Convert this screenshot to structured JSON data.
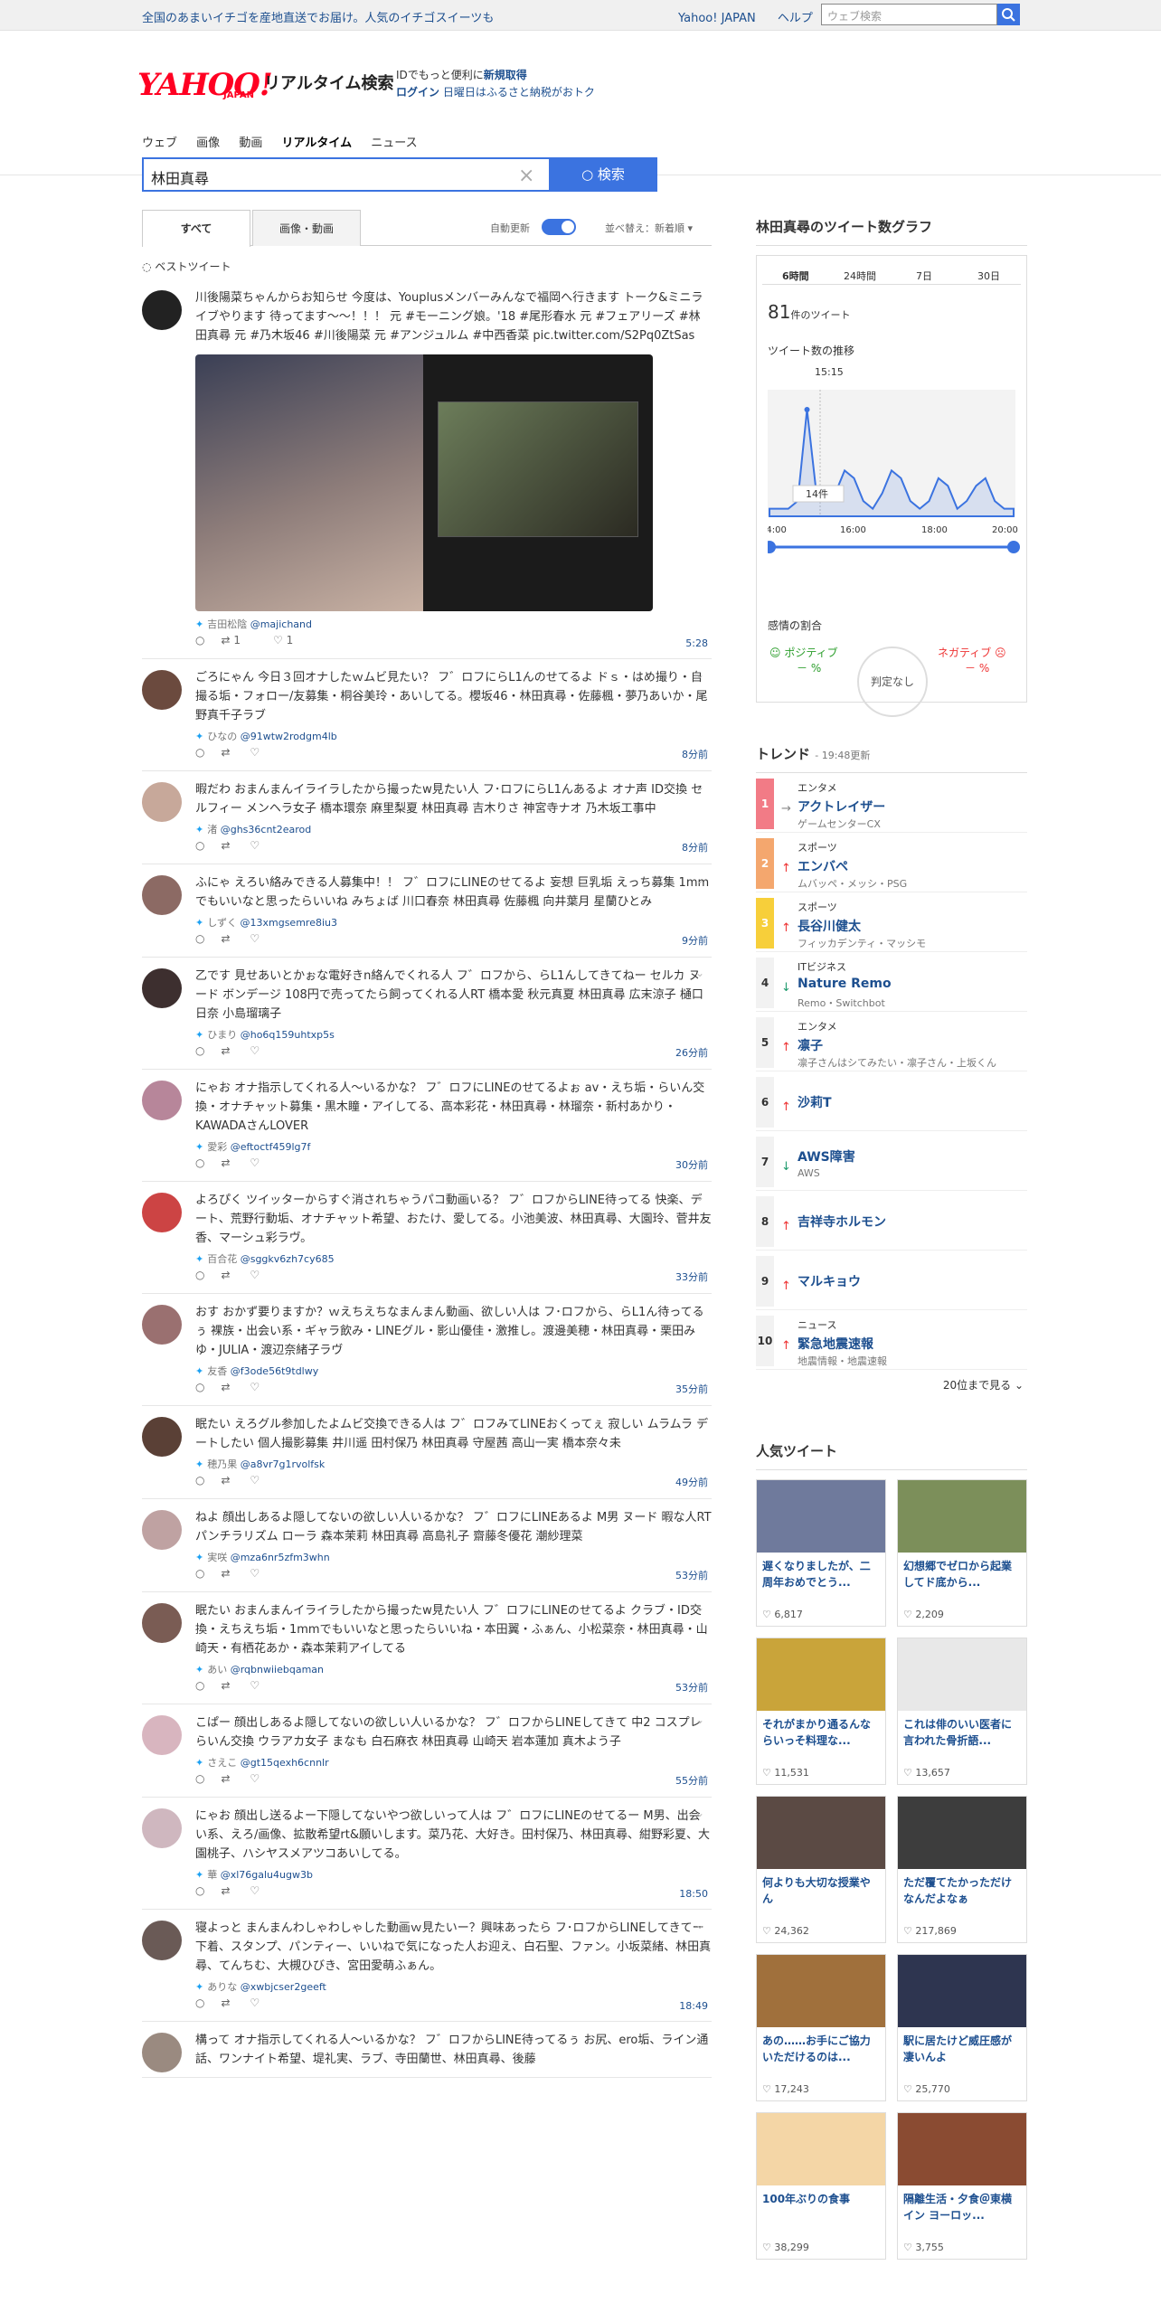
{
  "topbar": {
    "promo": "全国のあまいイチゴを産地直送でお届け。人気のイチゴスイーツも",
    "links": [
      "Yahoo! JAPAN",
      "ヘルプ"
    ],
    "search_placeholder": "ウェブ検索"
  },
  "header": {
    "logo": "YAHOO!",
    "logo_sub": "JAPAN",
    "title": "リアルタイム検索",
    "account_line1": "IDでもっと便利に",
    "account_link1": "新規取得",
    "account_link2": "ログイン",
    "account_line2": "日曜日はふるさと納税がおトク"
  },
  "nav": [
    "ウェブ",
    "画像",
    "動画",
    "リアルタイム",
    "ニュース"
  ],
  "search": {
    "query": "林田真尋",
    "button": "検索"
  },
  "tabs": {
    "all": "すべて",
    "media": "画像・動画",
    "auto_update": "自動更新",
    "sort": "並べ替え：新着順"
  },
  "best_label": "ベストツイート",
  "tweets": [
    {
      "text": "川後陽菜ちゃんからお知らせ 今度は、Youplusメンバーみんなで福岡へ行きます トーク&ミニライブやります 待ってます〜〜！！！ 元 #モーニング娘。'18 #尾形春水 元 #フェアリーズ #林田真尋 元 #乃木坂46 #川後陽菜 元 #アンジュルム #中西香菜 pic.twitter.com/S2Pq0ZtSas",
      "user": "吉田松陰",
      "screen": "@majichand",
      "time": "5:28",
      "rt": "1",
      "like": "1"
    },
    {
      "text": "ごろにゃん 今日３回オナしたｗムビ見たい？ フ゛ロフにらL1んのせてるよ ドｓ・はめ撮り・自撮る垢・フォロー/友募集・桐谷美玲・あいしてる。櫻坂46・林田真尋・佐藤楓・夢乃あいか・尾野真千子ラブ",
      "user": "ひなの",
      "screen": "@91wtw2rodgm4lb",
      "time": "8分前"
    },
    {
      "text": "暇だわ おまんまんイライラしたから撮ったw見たい人 フ･ロフにらL1んあるよ オナ声 ID交換 セルフィー メンヘラ女子 橋本環奈 麻里梨夏 林田真尋 吉木りさ 神宮寺ナオ 乃木坂工事中",
      "user": "渚",
      "screen": "@ghs36cnt2earod",
      "time": "8分前"
    },
    {
      "text": "ふにゃ えろい絡みできる人募集中！！ フ゛ロフにLINEのせてるよ 妄想 巨乳垢 えっち募集 1mmでもいいなと思ったらいいね みちょば 川口春奈 林田真尋 佐藤楓 向井葉月 星蘭ひとみ",
      "user": "しずく",
      "screen": "@13xmgsemre8iu3",
      "time": "9分前"
    },
    {
      "text": "乙です 見せあいとかぉな電好きn絡んでくれる人 フ゛ロフから、らL1んしてきてねー セルカ ヌード ボンデージ 108円で売ってたら飼ってくれる人RT 橋本愛 秋元真夏 林田真尋 広末涼子 樋口日奈 小島瑠璃子",
      "user": "ひまり",
      "screen": "@ho6q159uhtxp5s",
      "time": "26分前"
    },
    {
      "text": "にゃお オナ指示してくれる人〜いるかな？ フ゛ロフにLINEのせてるよぉ av・えち垢・らいん交換・オナチャット募集・黒木瞳・アイしてる、高本彩花・林田真尋・林瑠奈・新村あかり・KAWADAさんLOVER",
      "user": "愛彩",
      "screen": "@eftoctf459lg7f",
      "time": "30分前"
    },
    {
      "text": "よろぴく ツイッターからすぐ消されちゃうパコ動画いる？ フ゛ロフからLINE待ってる 快楽、デート、荒野行動垢、オナチャット希望、おたけ、愛してる。小池美波、林田真尋、大園玲、菅井友香、マーシュ彩ラヴ。",
      "user": "百合花",
      "screen": "@sggkv6zh7cy685",
      "time": "33分前"
    },
    {
      "text": "おす おかず要りますか？ｗえちえちなまんまん動画、欲しい人は フ･ロフから、らL1ん待ってるぅ 裸族・出会い系・ギャラ飲み・LINEグル・影山優佳・激推し。渡邊美穂・林田真尋・栗田みゆ・JULIA・渡辺奈緒子ラヴ",
      "user": "友香",
      "screen": "@f3ode56t9tdlwy",
      "time": "35分前"
    },
    {
      "text": "眠たい えろグル参加したよムビ交換できる人は フ゛ロフみてLINEおくってぇ 寂しい ムラムラ デートしたい 個人撮影募集 井川遥 田村保乃 林田真尋 守屋茜 高山一実 橋本奈々未",
      "user": "穂乃果",
      "screen": "@a8vr7g1rvolfsk",
      "time": "49分前"
    },
    {
      "text": "ねよ 顔出しあるよ隠してないの欲しい人いるかな？ フ゛ロフにLINEあるよ M男 ヌード 暇な人RT パンチラリズム ローラ 森本茉莉 林田真尋 高島礼子 齋藤冬優花 潮紗理菜",
      "user": "実咲",
      "screen": "@mza6nr5zfm3whn",
      "time": "53分前"
    },
    {
      "text": "眠たい おまんまんイライラしたから撮ったw見たい人 フ゛ロフにLINEのせてるよ クラブ・ID交換・えちえち垢・1mmでもいいなと思ったらいいね・本田翼・ふぁん、小松菜奈・林田真尋・山崎天・有栖花あか・森本茉莉アイしてる",
      "user": "あい",
      "screen": "@rqbnwiiebqaman",
      "time": "53分前"
    },
    {
      "text": "こぱー 顔出しあるよ隠してないの欲しい人いるかな？ フ゛ロフからLINEしてきて 中2 コスプレ らいん交換 ウラアカ女子 まなも 白石麻衣 林田真尋 山崎天 岩本蓮加 真木よう子",
      "user": "さえこ",
      "screen": "@gt15qexh6cnnlr",
      "time": "55分前"
    },
    {
      "text": "にゃお 顔出し送るよー下隠してないやつ欲しいって人は フ゛ロフにLINEのせてるー M男、出会い系、えろ/画像、拡散希望rt&願いします。菜乃花、大好き。田村保乃、林田真尋、紺野彩夏、大園桃子、ハシヤスメアツコあいしてる。",
      "user": "華",
      "screen": "@xl76galu4ugw3b",
      "time": "18:50"
    },
    {
      "text": "寝よっと まんまんわしゃわしゃした動画ｗ見たいー？興味あったら フ･ロフからLINEしてきてー 下着、スタンプ、パンティー、いいねで気になった人お迎え、白石聖、ファン。小坂菜緒、林田真尋、てんちむ、大槻ひびき、宮田愛萌ふぁん。",
      "user": "ありな",
      "screen": "@xwbjcser2geeft",
      "time": "18:49"
    },
    {
      "text": "構って オナ指示してくれる人〜いるかな？ フ゛ロフからLINE待ってるぅ お尻、ero垢、ライン通話、ワンナイト希望、堤礼実、ラブ、寺田蘭世、林田真尋、後藤",
      "user": "",
      "screen": "",
      "time": ""
    }
  ],
  "graph": {
    "title": "林田真尋のツイート数グラフ",
    "tabs": [
      "6時間",
      "24時間",
      "7日",
      "30日"
    ],
    "count": "81",
    "count_unit": "件のツイート",
    "trend_label": "ツイート数の推移",
    "peak_time": "15:15",
    "peak_count": "14件",
    "xticks": [
      "14:00",
      "16:00",
      "18:00",
      "20:00"
    ],
    "series": [
      1,
      1,
      1,
      2,
      14,
      3,
      2,
      3,
      6,
      5,
      2,
      1,
      3,
      6,
      5,
      2,
      1,
      2,
      5,
      4,
      1,
      2,
      4,
      5,
      2,
      1,
      1
    ],
    "emotion_label": "感情の割合",
    "positive": "ポジティブ",
    "negative": "ネガティブ",
    "neutral": "判定なし",
    "pos_val": "－ %",
    "neg_val": "－ %"
  },
  "trend": {
    "title": "トレンド",
    "updated": "19:48更新",
    "items": [
      {
        "rank": "1",
        "cat": "エンタメ",
        "name": "アクトレイザー",
        "sub": "ゲームセンターCX",
        "dir": "flat"
      },
      {
        "rank": "2",
        "cat": "スポーツ",
        "name": "エンバペ",
        "sub": "ムバッペ・メッシ・PSG",
        "dir": "up"
      },
      {
        "rank": "3",
        "cat": "スポーツ",
        "name": "長谷川健太",
        "sub": "フィッカデンティ・マッシモ",
        "dir": "up"
      },
      {
        "rank": "4",
        "cat": "ITビジネス",
        "name": "Nature Remo",
        "sub": "Remo・Switchbot",
        "dir": "down"
      },
      {
        "rank": "5",
        "cat": "エンタメ",
        "name": "凛子",
        "sub": "凛子さんはシてみたい・凛子さん・上坂くん",
        "dir": "up"
      },
      {
        "rank": "6",
        "cat": "",
        "name": "沙莉T",
        "sub": "",
        "dir": "up"
      },
      {
        "rank": "7",
        "cat": "",
        "name": "AWS障害",
        "sub": "AWS",
        "dir": "down"
      },
      {
        "rank": "8",
        "cat": "",
        "name": "吉祥寺ホルモン",
        "sub": "",
        "dir": "up"
      },
      {
        "rank": "9",
        "cat": "",
        "name": "マルキョウ",
        "sub": "",
        "dir": "up"
      },
      {
        "rank": "10",
        "cat": "ニュース",
        "name": "緊急地震速報",
        "sub": "地震情報・地震速報",
        "dir": "up"
      }
    ],
    "more": "20位まで見る"
  },
  "popular": {
    "title": "人気ツイート",
    "cards": [
      {
        "title": "遅くなりましたが、二周年おめでとう...",
        "likes": "6,817",
        "color": "#6f7a9c"
      },
      {
        "title": "幻想郷でゼロから起業してド底から...",
        "likes": "2,209",
        "color": "#7c8f5a"
      },
      {
        "title": "それがまかり通るんならいっそ料理な...",
        "likes": "11,531",
        "color": "#c9a43a"
      },
      {
        "title": "これは俳のいい医者に言われた骨折語...",
        "likes": "13,657",
        "color": "#e8e8e8"
      },
      {
        "title": "何よりも大切な授業やん",
        "likes": "24,362",
        "color": "#5b4a44"
      },
      {
        "title": "ただ覆てたかっただけなんだよなぁ",
        "likes": "217,869",
        "color": "#3d3d3d"
      },
      {
        "title": "あの……お手にご協力いただけるのは...",
        "likes": "17,243",
        "color": "#a0703c"
      },
      {
        "title": "駅に居たけど威圧感が凄いんよ",
        "likes": "25,770",
        "color": "#2e3550"
      },
      {
        "title": "100年ぶりの食事",
        "likes": "38,299",
        "color": "#f4d6a6"
      },
      {
        "title": "隔離生活・夕食＠東横イン ヨーロッ...",
        "likes": "3,755",
        "color": "#8a4b32"
      }
    ]
  },
  "colors": {
    "accent": "#3b73e0",
    "link": "#1d4f8f",
    "logo": "#ff0022"
  }
}
